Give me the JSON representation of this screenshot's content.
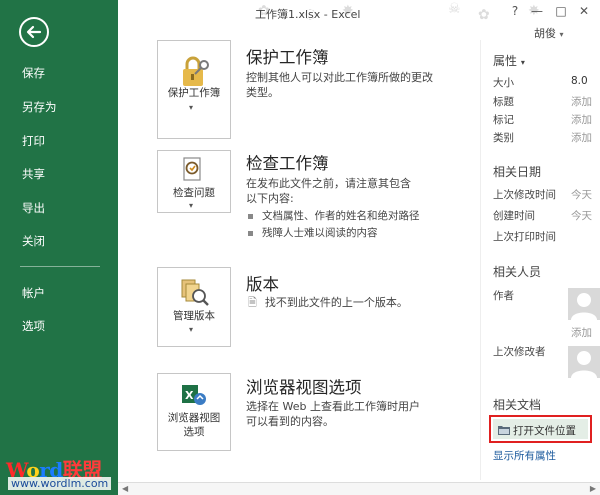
{
  "window": {
    "title": "工作簿1.xlsx - Excel",
    "user": "胡俊",
    "help": "?",
    "minimize": "—",
    "restore": "□",
    "close": "✕"
  },
  "sidebar": {
    "items": [
      {
        "label": "保存"
      },
      {
        "label": "另存为"
      },
      {
        "label": "打印"
      },
      {
        "label": "共享"
      },
      {
        "label": "导出"
      },
      {
        "label": "关闭"
      },
      {
        "label": "帐户"
      },
      {
        "label": "选项"
      }
    ]
  },
  "sections": {
    "protect": {
      "button_label": "保护工作簿",
      "title": "保护工作簿",
      "desc_line1": "控制其他人可以对此工作簿所做的更改",
      "desc_line2": "类型。"
    },
    "inspect": {
      "button_label": "检查问题",
      "title": "检查工作簿",
      "desc_line1": "在发布此文件之前，请注意其包含",
      "desc_line2": "以下内容:",
      "bullets": [
        "文档属性、作者的姓名和绝对路径",
        "残障人士难以阅读的内容"
      ]
    },
    "versions": {
      "button_label": "管理版本",
      "title": "版本",
      "desc": "找不到此文件的上一个版本。"
    },
    "browser": {
      "button_line1": "浏览器视图",
      "button_line2": "选项",
      "title": "浏览器视图选项",
      "desc_line1": "选择在 Web 上查看此工作簿时用户",
      "desc_line2": "可以看到的内容。"
    }
  },
  "properties": {
    "header": "属性",
    "caret": "▾",
    "rows": [
      {
        "key": "大小",
        "value": "8.0"
      },
      {
        "key": "标题",
        "value": "添加"
      },
      {
        "key": "标记",
        "value": "添加"
      },
      {
        "key": "类别",
        "value": "添加"
      }
    ]
  },
  "dates": {
    "header": "相关日期",
    "rows": [
      {
        "key": "上次修改时间",
        "value": "今天"
      },
      {
        "key": "创建时间",
        "value": "今天"
      },
      {
        "key": "上次打印时间",
        "value": ""
      }
    ]
  },
  "people": {
    "header": "相关人员",
    "author_label": "作者",
    "add_label": "添加",
    "modified_by_label": "上次修改者"
  },
  "documents": {
    "header": "相关文档",
    "open_location": "打开文件位置",
    "show_all": "显示所有属性"
  },
  "watermark": {
    "w": "W",
    "o": "o",
    "rd": "rd",
    "cn": "联盟",
    "url": "www.wordlm.com"
  },
  "colors": {
    "sidebar_bg": "#217346",
    "highlight_border": "#e02020",
    "link": "#1f5c9e"
  }
}
